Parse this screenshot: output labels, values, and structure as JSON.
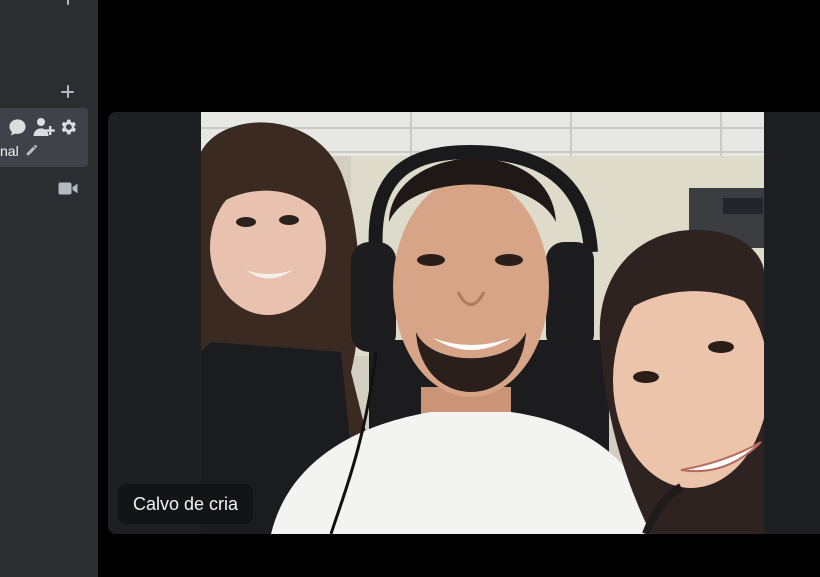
{
  "sidebar": {
    "channel_partial_label": "nal"
  },
  "video_tile": {
    "participant_name": "Calvo de cria"
  }
}
